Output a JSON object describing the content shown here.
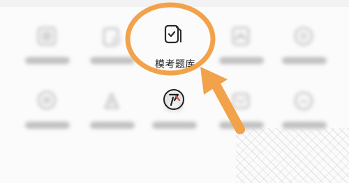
{
  "app": {
    "highlighted_menu_label": "模考题库"
  },
  "icons": {
    "mock_exam_icon": "document-check-icon",
    "japanese_char_icon": "katakana-a-icon",
    "annotation_arrow": "orange-arrow-icon"
  },
  "colors": {
    "highlight": "#f2a24a",
    "icon_stroke": "#2a2a2a",
    "accent_red": "#d9534f"
  }
}
